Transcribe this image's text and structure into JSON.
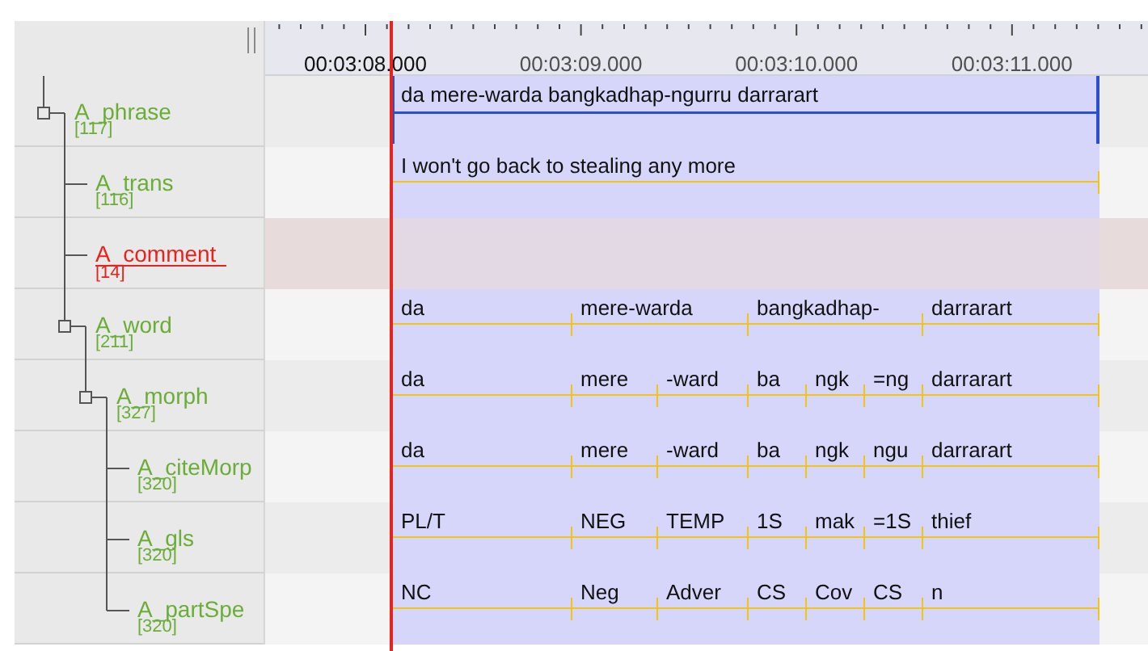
{
  "ruler": {
    "labels": [
      "00:03:08.000",
      "00:03:09.000",
      "00:03:10.000",
      "00:03:11.000"
    ]
  },
  "tiers": [
    {
      "name": "A_phrase",
      "count": "[117]",
      "active": false,
      "annotations": [
        "da mere-warda bangkadhap-ngurru darrarart"
      ],
      "children": [
        {
          "name": "A_trans",
          "count": "[116]",
          "active": false,
          "annotations": [
            "I won't go back to stealing any more"
          ]
        },
        {
          "name": "A_comment",
          "count": "[14]",
          "active": true
        },
        {
          "name": "A_word",
          "count": "[211]",
          "active": false,
          "annotations": [
            "da",
            "mere-warda",
            "bangkadhap-",
            "darrarart"
          ],
          "children": [
            {
              "name": "A_morph",
              "count": "[327]",
              "active": false,
              "annotations": [
                "da",
                "mere",
                "-ward",
                "ba",
                "ngk",
                "=ng",
                "darrarart"
              ],
              "children": [
                {
                  "name": "A_citeMorp",
                  "count": "[320]",
                  "active": false,
                  "annotations": [
                    "da",
                    "mere",
                    "-ward",
                    "ba",
                    "ngk",
                    "ngu",
                    "darrarart"
                  ]
                },
                {
                  "name": "A_gls",
                  "count": "[320]",
                  "active": false,
                  "annotations": [
                    "PL/T",
                    "NEG",
                    "TEMP",
                    "1S",
                    "mak",
                    "=1S",
                    "thief"
                  ]
                },
                {
                  "name": "A_partSpe",
                  "count": "[320]",
                  "active": false,
                  "annotations": [
                    "NC",
                    "Neg",
                    "Adver",
                    "CS",
                    "Cov",
                    "CS",
                    "n"
                  ]
                }
              ]
            }
          ]
        }
      ]
    }
  ]
}
